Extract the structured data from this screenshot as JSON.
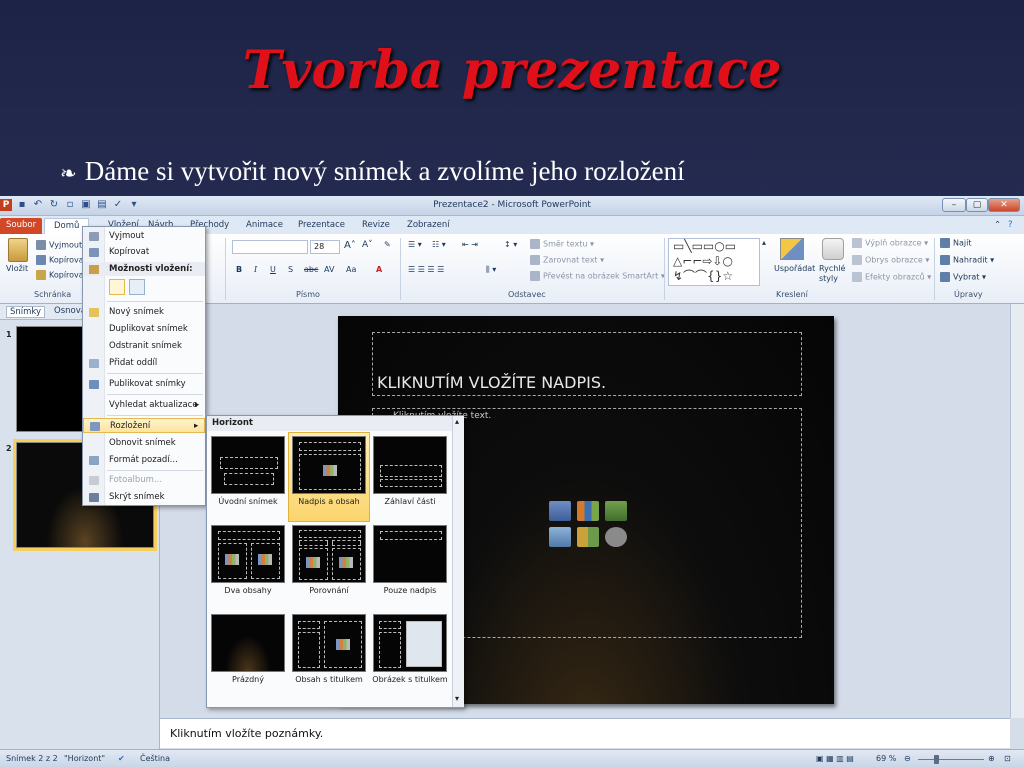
{
  "slide": {
    "title": "Tvorba prezentace",
    "bullet_symbol": "❧",
    "bullet": "Dáme si vytvořit nový snímek a zvolíme jeho rozložení"
  },
  "window": {
    "title": "Prezentace2 - Microsoft PowerPoint",
    "min": "–",
    "max": "▢",
    "close": "✕"
  },
  "tabs": [
    "Soubor",
    "Domů",
    "Vložení",
    "Návrh",
    "Přechody",
    "Animace",
    "Prezentace",
    "Revize",
    "Zobrazení"
  ],
  "ribbon": {
    "paste": "Vložit",
    "cut": "Vyjmout",
    "copy": "Kopírovat",
    "format_painter": "Kopírovat formát",
    "clipboard_group": "Schránka",
    "font_size": "28",
    "font_group": "Písmo",
    "text_direction": "Směr textu",
    "align_text": "Zarovnat text",
    "smartart": "Převést na obrázek SmartArt",
    "paragraph_group": "Odstavec",
    "arrange": "Uspořádat",
    "quick_styles": "Rychlé styly",
    "shape_fill": "Výplň obrazce",
    "shape_outline": "Obrys obrazce",
    "shape_effects": "Efekty obrazců",
    "drawing_group": "Kreslení",
    "find": "Najít",
    "replace": "Nahradit",
    "select": "Vybrat",
    "editing_group": "Úpravy"
  },
  "panel": {
    "tab_slides": "Snímky",
    "tab_outline": "Osnova",
    "thumb1_num": "1",
    "thumb2_num": "2"
  },
  "main_slide": {
    "title_placeholder": "KLIKNUTÍM VLOŽÍTE NADPIS.",
    "body_placeholder": "Kliknutím vložíte text."
  },
  "notes": "Kliknutím vložíte poznámky.",
  "status": {
    "slide": "Snímek 2 z 2",
    "theme": "\"Horizont\"",
    "language": "Čeština",
    "zoom": "69 %"
  },
  "context_menu": {
    "cut": "Vyjmout",
    "copy": "Kopírovat",
    "paste_options": "Možnosti vložení:",
    "new_slide": "Nový snímek",
    "duplicate": "Duplikovat snímek",
    "delete": "Odstranit snímek",
    "add_section": "Přidat oddíl",
    "publish": "Publikovat snímky",
    "check_updates": "Vyhledat aktualizace",
    "layout": "Rozložení",
    "reset": "Obnovit snímek",
    "format_bg": "Formát pozadí...",
    "photo_album": "Fotoalbum...",
    "hide": "Skrýt snímek"
  },
  "layout_gallery": {
    "header": "Horizont",
    "items": [
      "Úvodní snímek",
      "Nadpis a obsah",
      "Záhlaví části",
      "Dva obsahy",
      "Porovnání",
      "Pouze nadpis",
      "Prázdný",
      "Obsah s titulkem",
      "Obrázek s titulkem"
    ],
    "selected": "Nadpis a obsah"
  },
  "colors": {
    "title_red": "#e0101a",
    "file_tab": "#d24726",
    "selection": "#f6cf5f"
  }
}
